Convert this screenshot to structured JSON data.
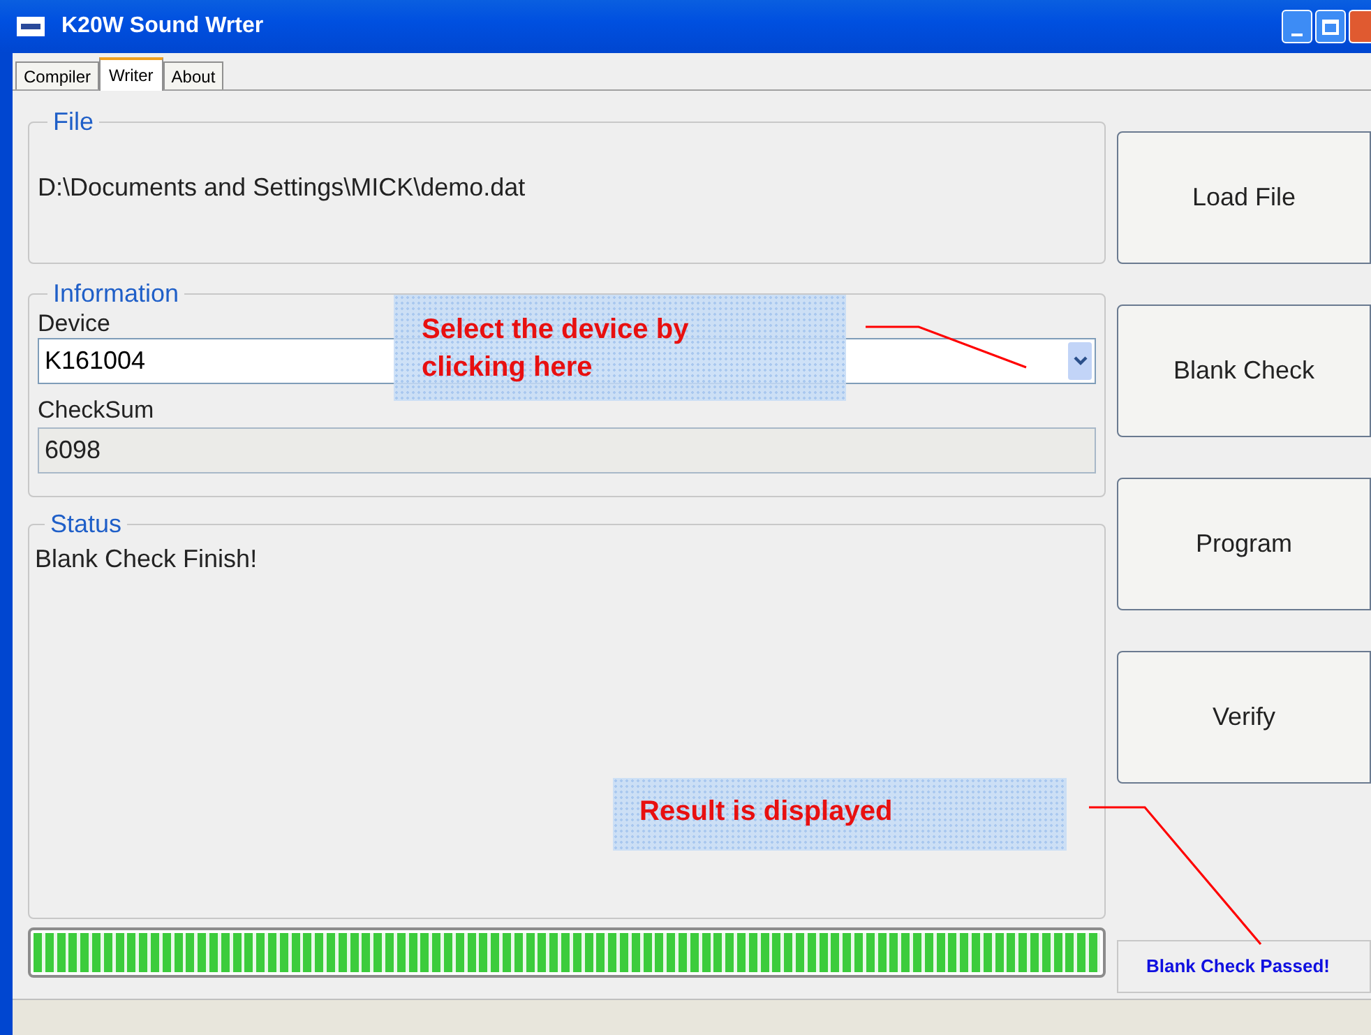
{
  "window": {
    "title": "K20W Sound Wrter"
  },
  "tabs": [
    {
      "label": "Compiler",
      "selected": false
    },
    {
      "label": "Writer",
      "selected": true
    },
    {
      "label": "About",
      "selected": false
    }
  ],
  "file": {
    "title": "File",
    "path": "D:\\Documents and Settings\\MICK\\demo.dat"
  },
  "information": {
    "title": "Information",
    "device_label": "Device",
    "device_value": "K161004",
    "checksum_label": "CheckSum",
    "checksum_value": "6098"
  },
  "status": {
    "title": "Status",
    "message": "Blank Check Finish!"
  },
  "buttons": [
    "Load File",
    "Blank Check",
    "Program",
    "Verify"
  ],
  "progress": {
    "level": 1
  },
  "result": "Blank Check Passed!",
  "annotations": [
    {
      "lines": [
        "Select the device by",
        "clicking here"
      ]
    },
    {
      "lines": [
        "Result is displayed"
      ]
    }
  ]
}
